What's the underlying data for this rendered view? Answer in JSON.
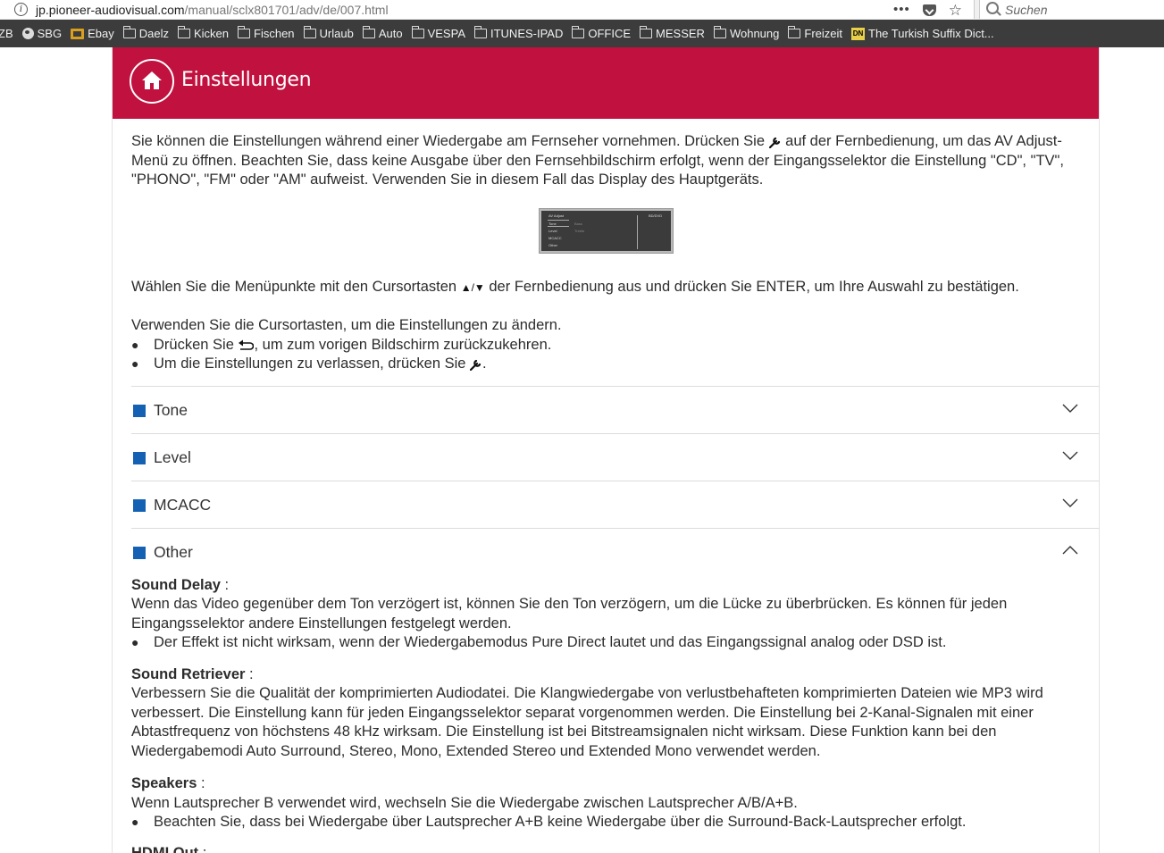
{
  "browser": {
    "url_host": "jp.pioneer-audiovisual.com",
    "url_path": "/manual/sclx801701/adv/de/007.html",
    "search_placeholder": "Suchen",
    "bookmarks": [
      {
        "label": "ZB",
        "icon": "none-icon"
      },
      {
        "label": "SBG",
        "icon": "globe-icon"
      },
      {
        "label": "Ebay",
        "icon": "ebay-icon"
      },
      {
        "label": "Daelz",
        "icon": "folder-icon"
      },
      {
        "label": "Kicken",
        "icon": "folder-icon"
      },
      {
        "label": "Fischen",
        "icon": "folder-icon"
      },
      {
        "label": "Urlaub",
        "icon": "folder-icon"
      },
      {
        "label": "Auto",
        "icon": "folder-icon"
      },
      {
        "label": "VESPA",
        "icon": "folder-icon"
      },
      {
        "label": "ITUNES-IPAD",
        "icon": "folder-icon"
      },
      {
        "label": "OFFICE",
        "icon": "folder-icon"
      },
      {
        "label": "MESSER",
        "icon": "folder-icon"
      },
      {
        "label": "Wohnung",
        "icon": "folder-icon"
      },
      {
        "label": "Freizeit",
        "icon": "folder-icon"
      },
      {
        "label": "The Turkish Suffix Dict...",
        "icon": "dn-icon",
        "icon_text": "DN"
      }
    ]
  },
  "header": {
    "title": "Einstellungen"
  },
  "intro": {
    "p1_a": "Sie können die Einstellungen während einer Wiedergabe am Fernseher vornehmen. Drücken Sie ",
    "p1_b": " auf der Fernbedienung, um das AV Adjust-Menü zu öffnen. Beachten Sie, dass keine Ausgabe über den Fernsehbildschirm erfolgt, wenn der Eingangsselektor die Einstellung \"CD\", \"TV\", \"PHONO\", \"FM\" oder \"AM\" aufweist. Verwenden Sie in diesem Fall das Display des Hauptgeräts.",
    "screen": {
      "title": "AV Adjust",
      "source": "BD/DVD",
      "items": [
        "Tone",
        "Level",
        "MCACC",
        "Other"
      ],
      "side": [
        "Bass",
        "Treble"
      ]
    },
    "p2_a": "Wählen Sie die Menüpunkte mit den Cursortasten ",
    "p2_arrows": "▲/▼",
    "p2_b": " der Fernbedienung aus und drücken Sie ENTER, um Ihre Auswahl zu bestätigen.",
    "p3": "Verwenden Sie die Cursortasten, um die Einstellungen zu ändern.",
    "bullet1_a": "Drücken Sie ",
    "bullet1_b": ", um zum vorigen Bildschirm zurückzukehren.",
    "bullet2_a": "Um die Einstellungen zu verlassen, drücken Sie ",
    "bullet2_b": ".",
    "bullet_char": "●"
  },
  "accordion": [
    {
      "label": "Tone",
      "expanded": false
    },
    {
      "label": "Level",
      "expanded": false
    },
    {
      "label": "MCACC",
      "expanded": false
    },
    {
      "label": "Other",
      "expanded": true
    }
  ],
  "other": {
    "sound_delay_title": "Sound Delay",
    "sound_delay_text": "Wenn das Video gegenüber dem Ton verzögert ist, können Sie den Ton verzögern, um die Lücke zu überbrücken. Es können für jeden Eingangsselektor andere Einstellungen festgelegt werden.",
    "sound_delay_bullet": "Der Effekt ist nicht wirksam, wenn der Wiedergabemodus Pure Direct lautet und das Eingangssignal analog oder DSD ist.",
    "sound_retriever_title": "Sound Retriever",
    "sound_retriever_text": "Verbessern Sie die Qualität der komprimierten Audiodatei. Die Klangwiedergabe von verlustbehafteten komprimierten Dateien wie MP3 wird verbessert. Die Einstellung kann für jeden Eingangsselektor separat vorgenommen werden. Die Einstellung bei 2-Kanal-Signalen mit einer Abtastfrequenz von höchstens 48 kHz wirksam. Die Einstellung ist bei Bitstreamsignalen nicht wirksam. Diese Funktion kann bei den Wiedergabemodi Auto Surround, Stereo, Mono, Extended Stereo und Extended Mono verwendet werden.",
    "speakers_title": "Speakers",
    "speakers_text": "Wenn Lautsprecher B verwendet wird, wechseln Sie die Wiedergabe zwischen Lautsprecher A/B/A+B.",
    "speakers_bullet": "Beachten Sie, dass bei Wiedergabe über Lautsprecher A+B keine Wiedergabe über die Surround-Back-Lautsprecher erfolgt.",
    "hdmi_title": "HDMI Out",
    "colon": " :"
  },
  "colors": {
    "banner": "#c0113f",
    "accordion_marker": "#1461b4"
  }
}
